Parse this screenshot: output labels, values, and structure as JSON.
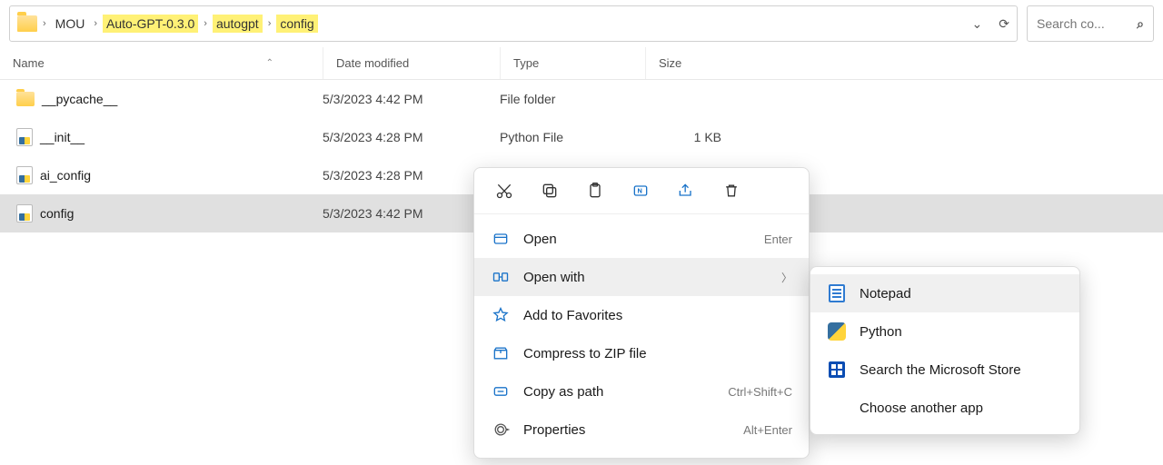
{
  "breadcrumb": [
    "MOU",
    "Auto-GPT-0.3.0",
    "autogpt",
    "config"
  ],
  "breadcrumb_highlight_from": 1,
  "search_placeholder": "Search co...",
  "columns": {
    "name": "Name",
    "date": "Date modified",
    "type": "Type",
    "size": "Size"
  },
  "files": [
    {
      "icon": "folder",
      "name": "__pycache__",
      "date": "5/3/2023 4:42 PM",
      "type": "File folder",
      "size": "",
      "selected": false
    },
    {
      "icon": "py",
      "name": "__init__",
      "date": "5/3/2023 4:28 PM",
      "type": "Python File",
      "size": "1 KB",
      "selected": false
    },
    {
      "icon": "py",
      "name": "ai_config",
      "date": "5/3/2023 4:28 PM",
      "type": "",
      "size": "",
      "selected": false
    },
    {
      "icon": "py",
      "name": "config",
      "date": "5/3/2023 4:42 PM",
      "type": "",
      "size": "",
      "selected": true
    }
  ],
  "context_menu": {
    "icons": [
      "cut",
      "copy",
      "paste",
      "rename",
      "share",
      "delete"
    ],
    "items": [
      {
        "icon": "open",
        "label": "Open",
        "shortcut": "Enter"
      },
      {
        "icon": "openwith",
        "label": "Open with",
        "submenu": true,
        "hover": true
      },
      {
        "icon": "star",
        "label": "Add to Favorites"
      },
      {
        "icon": "zip",
        "label": "Compress to ZIP file"
      },
      {
        "icon": "path",
        "label": "Copy as path",
        "shortcut": "Ctrl+Shift+C"
      },
      {
        "icon": "props",
        "label": "Properties",
        "shortcut": "Alt+Enter"
      }
    ]
  },
  "submenu": [
    {
      "icon": "notepad",
      "label": "Notepad",
      "hover": true
    },
    {
      "icon": "python",
      "label": "Python"
    },
    {
      "icon": "store",
      "label": "Search the Microsoft Store"
    },
    {
      "icon": "",
      "label": "Choose another app"
    }
  ]
}
